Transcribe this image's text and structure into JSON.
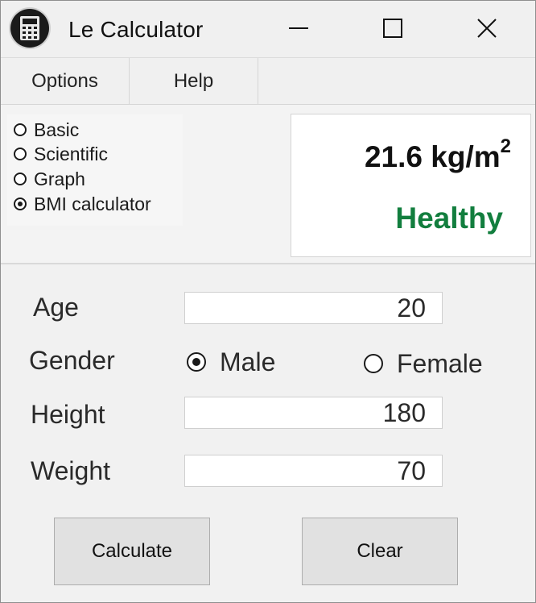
{
  "window": {
    "title": "Le Calculator",
    "icon": "calculator-icon",
    "controls": {
      "minimize": "minimize-icon",
      "maximize": "maximize-icon",
      "close": "close-icon"
    }
  },
  "menu": {
    "options": "Options",
    "help": "Help"
  },
  "modes": [
    {
      "label": "Basic",
      "selected": false
    },
    {
      "label": "Scientific",
      "selected": false
    },
    {
      "label": "Graph",
      "selected": false
    },
    {
      "label": "BMI calculator",
      "selected": true
    }
  ],
  "result": {
    "value": "21.6 kg/m",
    "unit_exponent": "2",
    "status": "Healthy",
    "status_color": "#127e3e"
  },
  "form": {
    "age_label": "Age",
    "age_value": "20",
    "gender_label": "Gender",
    "gender_options": [
      {
        "label": "Male",
        "selected": true
      },
      {
        "label": "Female",
        "selected": false
      }
    ],
    "height_label": "Height",
    "height_value": "180",
    "weight_label": "Weight",
    "weight_value": "70"
  },
  "buttons": {
    "calculate": "Calculate",
    "clear": "Clear"
  }
}
